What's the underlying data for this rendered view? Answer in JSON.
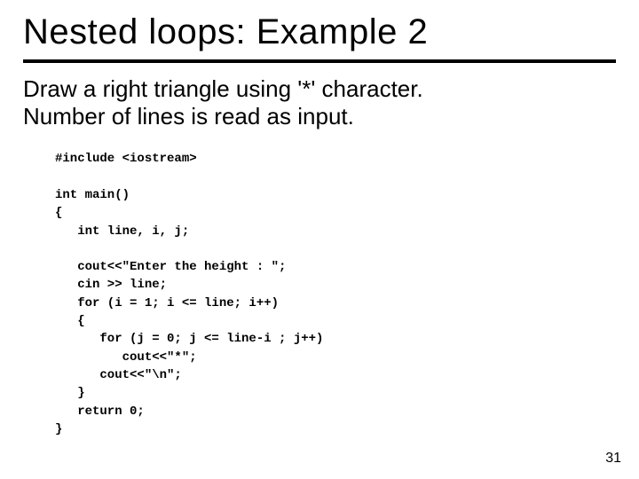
{
  "slide": {
    "title": "Nested loops: Example 2",
    "description_line1": "Draw a right triangle using '*' character.",
    "description_line2": "Number of lines is read as input.",
    "code": "#include <iostream>\n\nint main()\n{\n   int line, i, j;\n\n   cout<<\"Enter the height : \";\n   cin >> line;\n   for (i = 1; i <= line; i++)\n   {\n      for (j = 0; j <= line-i ; j++)\n         cout<<\"*\";\n      cout<<\"\\n\";\n   }\n   return 0;\n}",
    "page_number": "31"
  }
}
